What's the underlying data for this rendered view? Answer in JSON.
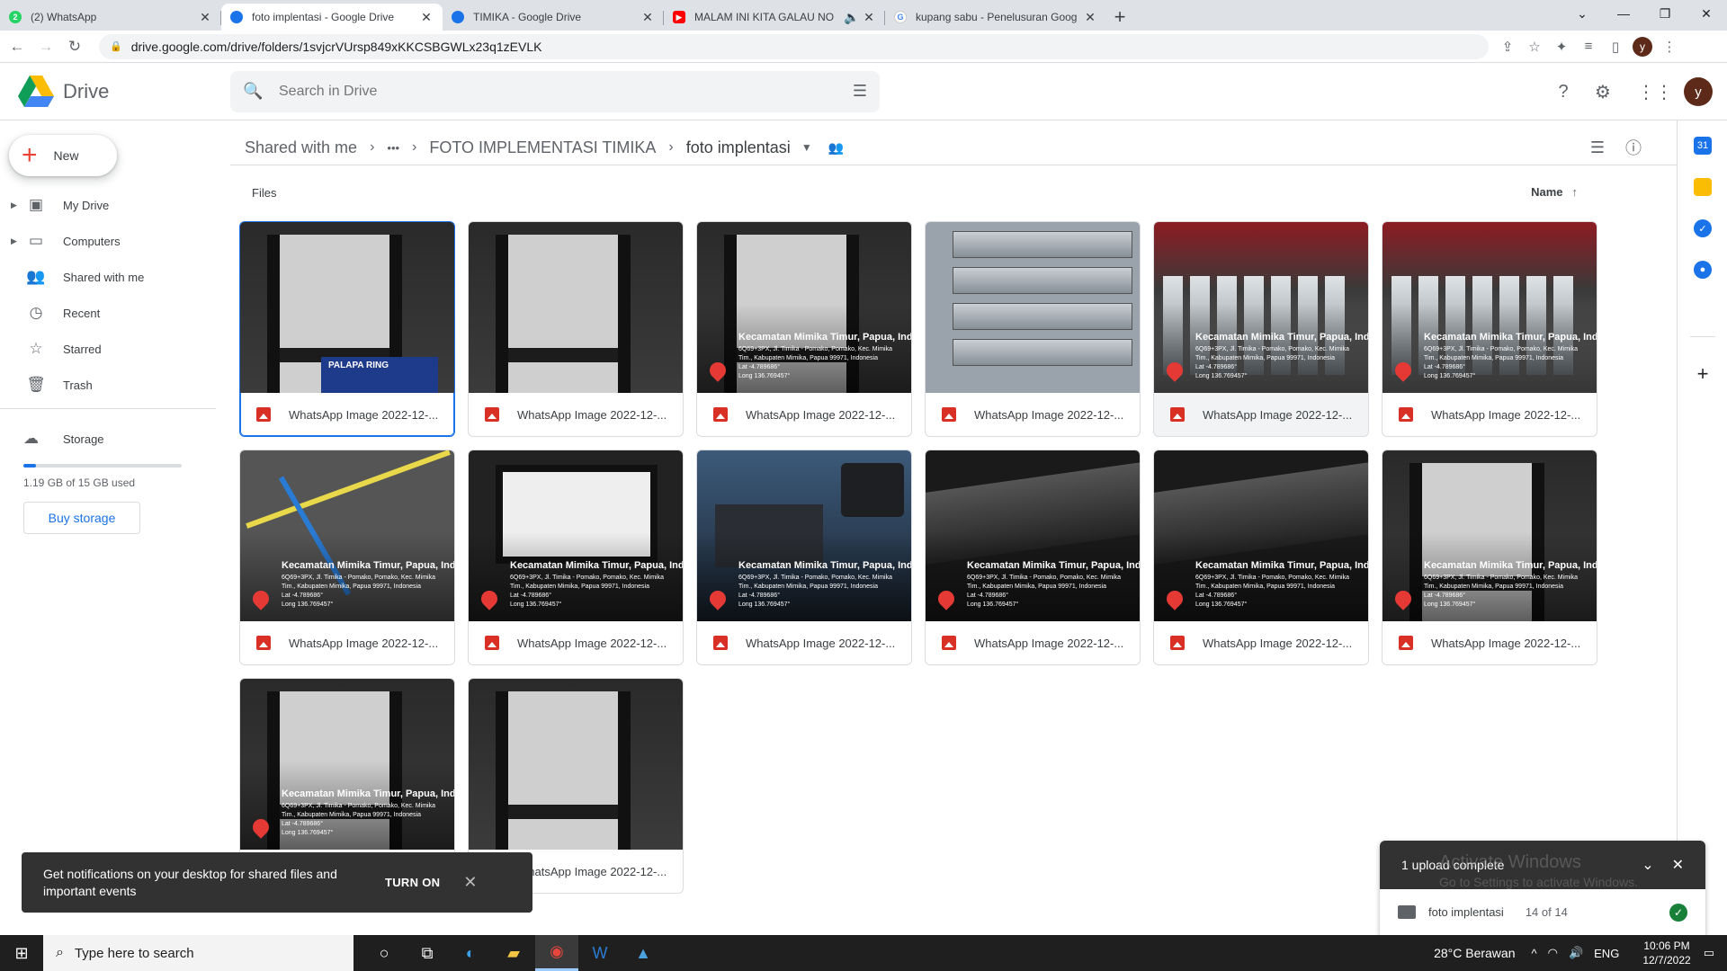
{
  "browser": {
    "tabs": [
      {
        "title": "(2) WhatsApp",
        "icon": "whatsapp-icon",
        "color": "#25d366",
        "active": false
      },
      {
        "title": "foto implentasi - Google Drive",
        "icon": "drive-icon",
        "color": "#1a73e8",
        "active": true
      },
      {
        "title": "TIMIKA - Google Drive",
        "icon": "drive-icon",
        "color": "#1a73e8",
        "active": false
      },
      {
        "title": "MALAM INI KITA GALAU NO",
        "icon": "youtube-icon",
        "color": "#ff0000",
        "active": false
      },
      {
        "title": "kupang sabu - Penelusuran Goog",
        "icon": "google-icon",
        "color": "#4285f4",
        "active": false
      }
    ],
    "url": "drive.google.com/drive/folders/1svjcrVUrsp849xKKCSBGWLx23q1zEVLK",
    "profile_initial": "y"
  },
  "drive": {
    "app_name": "Drive",
    "search_placeholder": "Search in Drive",
    "user_initial": "y",
    "new_label": "New",
    "nav": [
      {
        "label": "My Drive",
        "icon": "my-drive-icon"
      },
      {
        "label": "Computers",
        "icon": "computers-icon"
      },
      {
        "label": "Shared with me",
        "icon": "shared-icon"
      },
      {
        "label": "Recent",
        "icon": "clock-icon"
      },
      {
        "label": "Starred",
        "icon": "star-icon"
      },
      {
        "label": "Trash",
        "icon": "trash-icon"
      }
    ],
    "storage": {
      "label": "Storage",
      "used_text": "1.19 GB of 15 GB used",
      "used_fraction": 0.079,
      "buy_label": "Buy storage"
    },
    "breadcrumb": {
      "root": "Shared with me",
      "more": "•••",
      "parent": "FOTO IMPLEMENTASI TIMIKA",
      "current": "foto implentasi"
    },
    "files_header": "Files",
    "sort_label": "Name",
    "files": [
      {
        "name": "WhatsApp Image 2022-12-...",
        "type": "rack"
      },
      {
        "name": "WhatsApp Image 2022-12-...",
        "type": "rack"
      },
      {
        "name": "WhatsApp Image 2022-12-...",
        "type": "rack-gps"
      },
      {
        "name": "WhatsApp Image 2022-12-...",
        "type": "sfp"
      },
      {
        "name": "WhatsApp Image 2022-12-...",
        "type": "red-gps"
      },
      {
        "name": "WhatsApp Image 2022-12-...",
        "type": "red-gps"
      },
      {
        "name": "WhatsApp Image 2022-12-...",
        "type": "wire-gps"
      },
      {
        "name": "WhatsApp Image 2022-12-...",
        "type": "screen-gps"
      },
      {
        "name": "WhatsApp Image 2022-12-...",
        "type": "dev-gps"
      },
      {
        "name": "WhatsApp Image 2022-12-...",
        "type": "apc-gps"
      },
      {
        "name": "WhatsApp Image 2022-12-...",
        "type": "apc-gps"
      },
      {
        "name": "WhatsApp Image 2022-12-...",
        "type": "rack-gps"
      },
      {
        "name": "WhatsApp Image 2022-12-...",
        "type": "rack-gps"
      },
      {
        "name": "WhatsApp Image 2022-12-...",
        "type": "rack"
      }
    ],
    "gps_text": {
      "line1": "Kecamatan Mimika Timur, Papua, Indonesia",
      "line2": "6Q69+3PX, Jl. Timika - Pomako, Pomako, Kec. Mimika",
      "line3": "Tim., Kabupaten Mimika, Papua 99971, Indonesia",
      "line4": "Lat -4.789686°",
      "line5": "Long 136.769457°"
    },
    "palapa_text": "PALAPA RING"
  },
  "notification": {
    "message": "Get notifications on your desktop for shared files and important events",
    "action": "TURN ON"
  },
  "upload": {
    "title": "1 upload complete",
    "folder": "foto implentasi",
    "count": "14 of 14"
  },
  "watermark": {
    "title": "Activate Windows",
    "subtitle": "Go to Settings to activate Windows."
  },
  "taskbar": {
    "search_placeholder": "Type here to search",
    "weather": "28°C  Berawan",
    "lang": "ENG",
    "time": "10:06 PM",
    "date": "12/7/2022"
  }
}
